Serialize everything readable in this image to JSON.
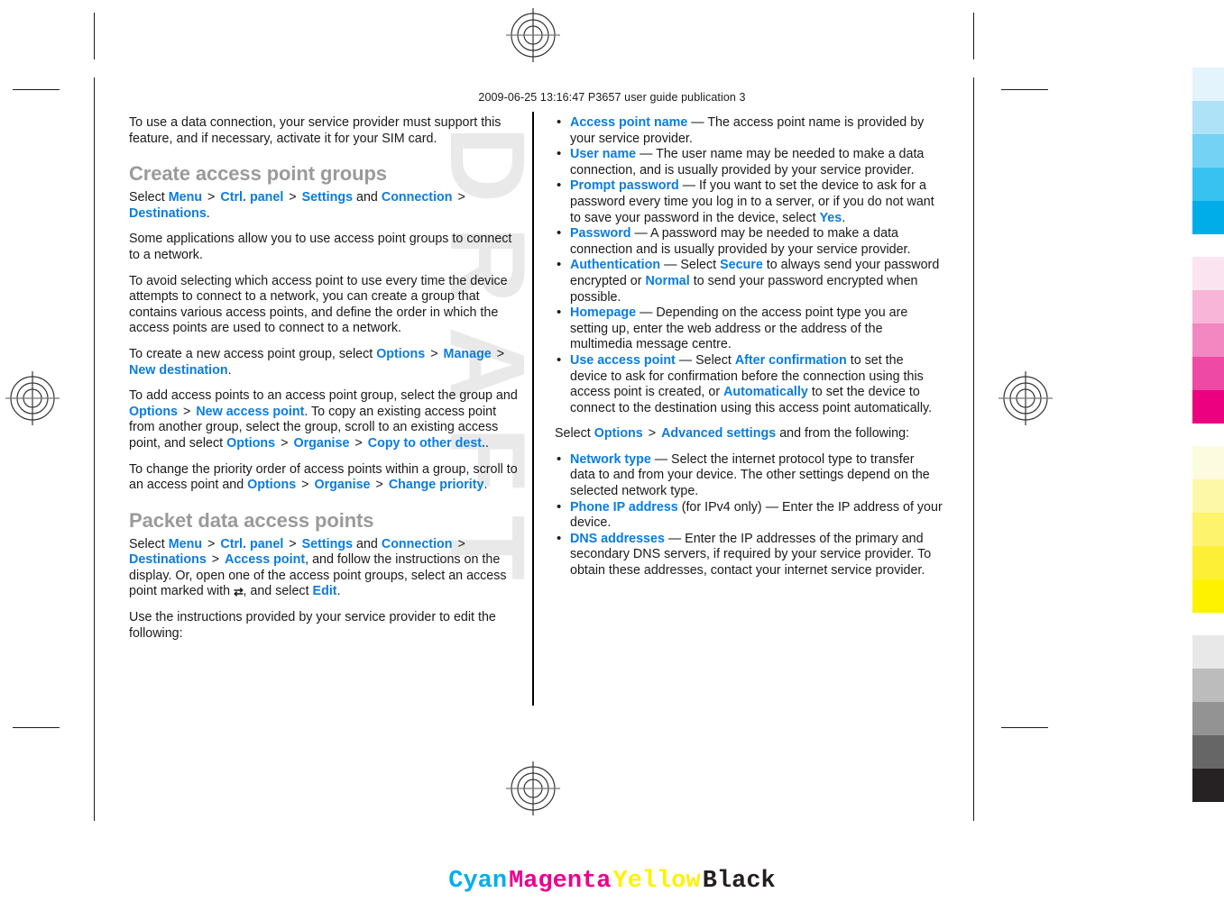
{
  "page": {
    "header": "2009-06-25 13:16:47 P3657 user guide publication 3",
    "watermark": "DRAFT"
  },
  "left_column": {
    "intro_paragraph": "To use a data connection, your service provider must support this feature, and if necessary, activate it for your SIM card.",
    "heading_1": "Create access point groups",
    "select_label": "Select",
    "and_label": "and",
    "gt": ">",
    "menu": "Menu",
    "ctrl_panel": "Ctrl. panel",
    "settings": "Settings",
    "connection": "Connection",
    "destinations": "Destinations",
    "period": ".",
    "para_some_applications": "Some applications allow you to use access point groups to connect to a network.",
    "para_to_avoid": "To avoid selecting which access point to use every time the device attempts to connect to a network, you can create a group that contains various access points, and define the order in which the access points are used to connect to a network.",
    "para_create_new_prefix": "To create a new access point group, select",
    "options": "Options",
    "manage": "Manage",
    "new_destination": "New destination",
    "para_add_prefix": "To add access points to an access point group, select the group and",
    "new_access_point": "New access point",
    "para_add_mid": ". To copy an existing access point from another group, select the group, scroll to an existing access point, and select",
    "organise": "Organise",
    "copy_to_other_dest": "Copy to other dest.",
    "para_priority_prefix": "To change the priority order of access points within a group, scroll to an access point and",
    "change_priority": "Change priority",
    "heading_2": "Packet data access points",
    "access_point": "Access point",
    "para_follow_instructions": ", and follow the instructions on the display. Or, open one of the access point groups, select an access point marked with",
    "marked_icon": "⇄",
    "para_and_select": ", and select",
    "edit": "Edit",
    "para_use_instructions": "Use the instructions provided by your service provider to edit the following:"
  },
  "right_column": {
    "items_basic": [
      {
        "term": "Access point name",
        "dash": "—",
        "desc": "The access point name is provided by your service provider."
      },
      {
        "term": "User name",
        "dash": "—",
        "desc": "The user name may be needed to make a data connection, and is usually provided by your service provider."
      },
      {
        "term": "Prompt password",
        "dash": "—",
        "desc_before": "If you want to set the device to ask for a password every time you log in to a server, or if you do not want to save your password in the device, select",
        "value": "Yes",
        "desc_after": "."
      },
      {
        "term": "Password",
        "dash": "—",
        "desc": "A password may be needed to make a data connection and is usually provided by your service provider."
      },
      {
        "term": "Authentication",
        "dash": "—",
        "desc_before": "Select",
        "value_1": "Secure",
        "desc_mid": "to always send your password encrypted or",
        "value_2": "Normal",
        "desc_after": "to send your password encrypted when possible."
      },
      {
        "term": "Homepage",
        "dash": "—",
        "desc": "Depending on the access point type you are setting up, enter the web address or the address of the multimedia message centre."
      },
      {
        "term": "Use access point",
        "dash": "—",
        "desc_before": "Select",
        "value_1": "After confirmation",
        "desc_mid": "to set the device to ask for confirmation before the connection using this access point is created, or",
        "value_2": "Automatically",
        "desc_after": "to set the device to connect to the destination using this access point automatically."
      }
    ],
    "advanced_intro": {
      "select_label": "Select",
      "options": "Options",
      "gt": ">",
      "advanced_settings": "Advanced settings",
      "tail": "and from the following:"
    },
    "items_advanced": [
      {
        "term": "Network type",
        "dash": "—",
        "desc": "Select the internet protocol type to transfer data to and from your device. The other settings depend on the selected network type."
      },
      {
        "term": "Phone IP address",
        "paren": "(for IPv4 only)",
        "dash": "—",
        "desc": "Enter the IP address of your device."
      },
      {
        "term": "DNS addresses",
        "dash": "—",
        "desc": "Enter the IP addresses of the primary and secondary DNS servers, if required by your service provider. To obtain these addresses, contact your internet service provider."
      }
    ]
  },
  "color_bars": {
    "cyan": [
      "#e4f4fc",
      "#aee2f7",
      "#74d2f4",
      "#38c2f0",
      "#00ade9"
    ],
    "magenta": [
      "#fbe4f0",
      "#f8b5d8",
      "#f287c2",
      "#ee49a5",
      "#ec0080"
    ],
    "yellow": [
      "#fdfbdf",
      "#fdf8a8",
      "#fdf36d",
      "#fdef35",
      "#fff200"
    ],
    "black": [
      "#e8e8e8",
      "#bcbcbc",
      "#939393",
      "#666666",
      "#262224"
    ]
  },
  "cmyk_footer": [
    {
      "label": "Cyan",
      "color": "#00aeef"
    },
    {
      "label": "Magenta",
      "color": "#ec008c"
    },
    {
      "label": "Yellow",
      "color": "#fff200"
    },
    {
      "label": "Black",
      "color": "#231f20"
    }
  ]
}
